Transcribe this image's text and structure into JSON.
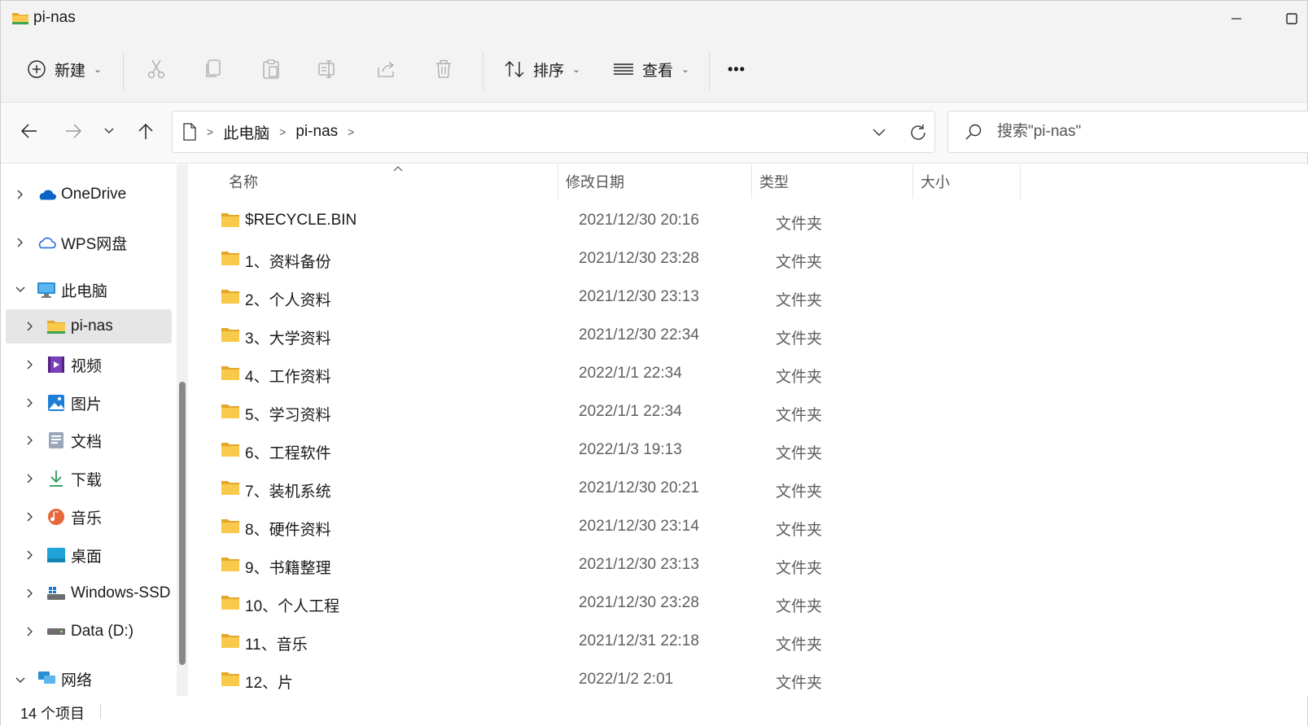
{
  "window": {
    "title": "pi-nas"
  },
  "commandbar": {
    "new_label": "新建",
    "sort_label": "排序",
    "view_label": "查看",
    "more_label": "•••"
  },
  "address": {
    "crumbs": [
      "此电脑",
      "pi-nas"
    ]
  },
  "search": {
    "placeholder": "搜索\"pi-nas\""
  },
  "sidebar": {
    "items": [
      {
        "label": "OneDrive",
        "icon": "onedrive-cloud-icon",
        "expanded": false
      },
      {
        "label": "WPS网盘",
        "icon": "wps-cloud-icon",
        "expanded": false
      },
      {
        "label": "此电脑",
        "icon": "computer-monitor-icon",
        "expanded": true
      },
      {
        "label": "pi-nas",
        "icon": "network-folder-icon",
        "selected": true
      },
      {
        "label": "视频",
        "icon": "video-icon"
      },
      {
        "label": "图片",
        "icon": "pictures-icon"
      },
      {
        "label": "文档",
        "icon": "documents-icon"
      },
      {
        "label": "下载",
        "icon": "download-icon"
      },
      {
        "label": "音乐",
        "icon": "music-icon"
      },
      {
        "label": "桌面",
        "icon": "desktop-icon"
      },
      {
        "label": "Windows-SSD",
        "icon": "windows-drive-icon"
      },
      {
        "label": "Data (D:)",
        "icon": "drive-icon"
      },
      {
        "label": "网络",
        "icon": "network-icon"
      }
    ]
  },
  "columns": {
    "name": "名称",
    "modified": "修改日期",
    "type": "类型",
    "size": "大小"
  },
  "files": [
    {
      "name": "$RECYCLE.BIN",
      "modified": "2021/12/30 20:16",
      "type": "文件夹"
    },
    {
      "name": "1、资料备份",
      "modified": "2021/12/30 23:28",
      "type": "文件夹"
    },
    {
      "name": "2、个人资料",
      "modified": "2021/12/30 23:13",
      "type": "文件夹"
    },
    {
      "name": "3、大学资料",
      "modified": "2021/12/30 22:34",
      "type": "文件夹"
    },
    {
      "name": "4、工作资料",
      "modified": "2022/1/1 22:34",
      "type": "文件夹"
    },
    {
      "name": "5、学习资料",
      "modified": "2022/1/1 22:34",
      "type": "文件夹"
    },
    {
      "name": "6、工程软件",
      "modified": "2022/1/3 19:13",
      "type": "文件夹"
    },
    {
      "name": "7、装机系统",
      "modified": "2021/12/30 20:21",
      "type": "文件夹"
    },
    {
      "name": "8、硬件资料",
      "modified": "2021/12/30 23:14",
      "type": "文件夹"
    },
    {
      "name": "9、书籍整理",
      "modified": "2021/12/30 23:13",
      "type": "文件夹"
    },
    {
      "name": "10、个人工程",
      "modified": "2021/12/30 23:28",
      "type": "文件夹"
    },
    {
      "name": "11、音乐",
      "modified": "2021/12/31 22:18",
      "type": "文件夹"
    },
    {
      "name": "12、片",
      "modified": "2022/1/2 2:01",
      "type": "文件夹"
    }
  ],
  "status": {
    "item_count": "14 个项目"
  },
  "colors": {
    "folder_yellow": "#f8c94a",
    "folder_dark": "#e3a72a",
    "accent_blue": "#0a64c8",
    "selected_bg": "#e5e5e5"
  }
}
